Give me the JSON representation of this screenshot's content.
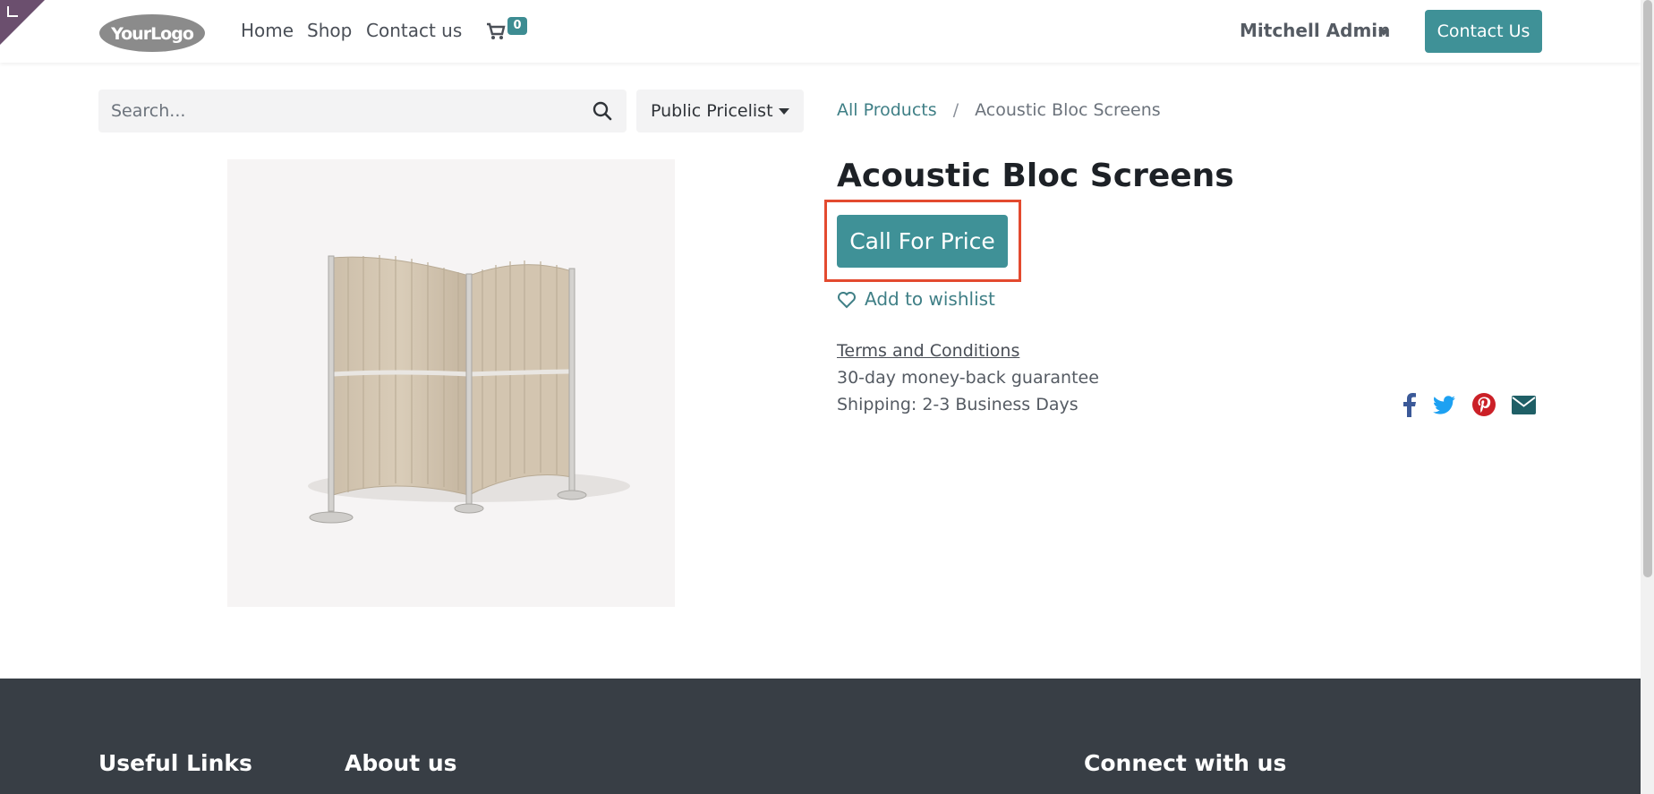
{
  "navbar": {
    "logo_text": "YourLogo",
    "links": [
      "Home",
      "Shop",
      "Contact us"
    ],
    "cart_count": "0",
    "user": "Mitchell Admin",
    "contact_button": "Contact Us"
  },
  "search": {
    "placeholder": "Search...",
    "pricelist": "Public Pricelist"
  },
  "breadcrumb": {
    "parent": "All Products",
    "separator": "/",
    "current": "Acoustic Bloc Screens"
  },
  "product": {
    "title": "Acoustic Bloc Screens",
    "price_button": "Call For Price",
    "wishlist": "Add to wishlist",
    "terms": "Terms and Conditions",
    "guarantee": "30-day money-back guarantee",
    "shipping": "Shipping: 2-3 Business Days"
  },
  "share_icons": [
    "facebook-icon",
    "twitter-icon",
    "pinterest-icon",
    "envelope-icon"
  ],
  "footer": {
    "col1": "Useful Links",
    "col2": "About us",
    "col3": "Connect with us"
  },
  "colors": {
    "accent": "#3f9197",
    "highlight": "#e34a2f",
    "footer_bg": "#383e45"
  }
}
